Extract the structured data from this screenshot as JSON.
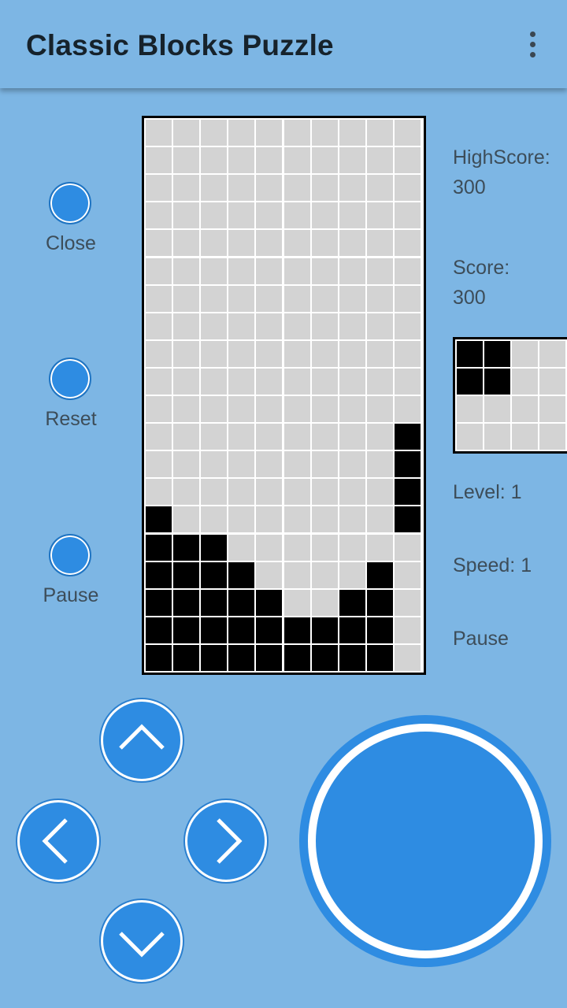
{
  "app": {
    "title": "Classic Blocks Puzzle",
    "menu_icon": "more-vert-icon"
  },
  "side_buttons": {
    "close": "Close",
    "reset": "Reset",
    "pause": "Pause"
  },
  "stats": {
    "highscore_label": "HighScore:",
    "highscore_value": "300",
    "score_label": "Score:",
    "score_value": "300",
    "level_label": "Level:",
    "level_value": "1",
    "speed_label": "Speed:",
    "speed_value": "1",
    "state_label": "Pause"
  },
  "board": {
    "cols": 10,
    "rows": 20,
    "grid": [
      "0000000000",
      "0000000000",
      "0000000000",
      "0000000000",
      "0000000000",
      "0000000000",
      "0000000000",
      "0000000000",
      "0000000000",
      "0000000000",
      "0000000000",
      "0000000001",
      "0000000001",
      "0000000001",
      "1000000001",
      "1110000000",
      "1111000010",
      "1111100110",
      "1111111110",
      "1111111110"
    ]
  },
  "next_piece": {
    "grid": [
      "1100",
      "1100",
      "0000",
      "0000"
    ]
  },
  "controls": {
    "up_icon": "chevron-up-icon",
    "down_icon": "chevron-down-icon",
    "left_icon": "chevron-left-icon",
    "right_icon": "chevron-right-icon",
    "drop_icon": "drop-action-icon"
  },
  "colors": {
    "background": "#7db6e4",
    "accent": "#2e8ce2",
    "block_on": "#000000",
    "block_off": "#d3d3d3"
  }
}
